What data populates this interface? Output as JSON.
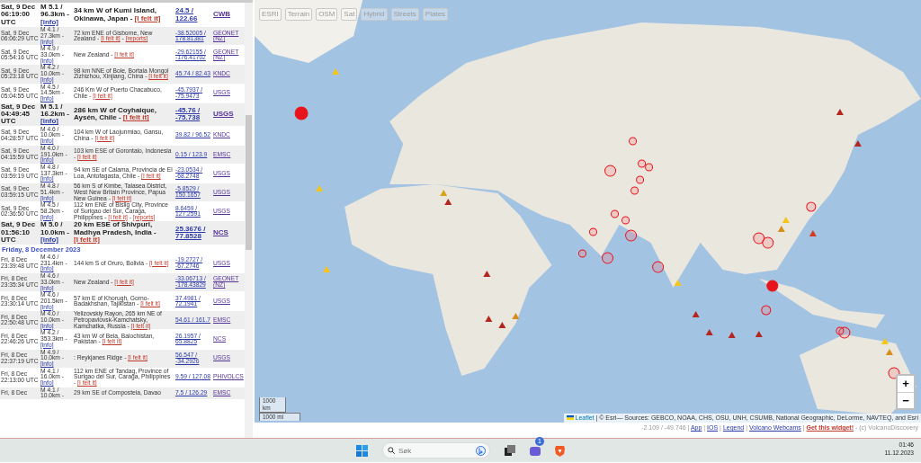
{
  "link_separator": " - ",
  "quake_list": {
    "rows": [
      {
        "kind": "quake",
        "strong": true,
        "date": "Sat, 9 Dec 06:19:00 UTC",
        "magnitude": "M 5.1 / 96.3km -",
        "info": "[info]",
        "place": "34 km W of Kumi Island, Okinawa, Japan",
        "links": [
          "[I felt it]"
        ],
        "coords": "24.5 / 122.66",
        "source": "CWB"
      },
      {
        "kind": "quake",
        "strong": false,
        "date": "Sat, 9 Dec 06:06:29 UTC",
        "magnitude": "M 4.1 / 27.3km -",
        "info": "[info]",
        "place": "72 km ENE of Gisborne, New Zealand",
        "links": [
          "[I felt it]",
          "[reports]"
        ],
        "coords": "-38.52005 / 178.81381",
        "source": "GEONET (NZ)"
      },
      {
        "kind": "quake",
        "strong": false,
        "date": "Sat, 9 Dec 05:54:16 UTC",
        "magnitude": "M 4.9 / 33.0km -",
        "info": "[info]",
        "place": "New Zealand",
        "links": [
          "[I felt it]"
        ],
        "coords": "-29.62155 / -176.41702",
        "source": "GEONET (NZ)"
      },
      {
        "kind": "quake",
        "strong": false,
        "date": "Sat, 9 Dec 05:23:18 UTC",
        "magnitude": "M 4.2 / 10.0km -",
        "info": "[info]",
        "place": "98 km NNE of Bole, Bortala Mongol Zizhizhou, Xinjiang, China",
        "links": [
          "[I felt it]"
        ],
        "coords": "45.74 / 82.43",
        "source": "KNDC"
      },
      {
        "kind": "quake",
        "strong": false,
        "date": "Sat, 9 Dec 05:04:55 UTC",
        "magnitude": "M 4.5 / 14.5km -",
        "info": "[info]",
        "place": "246 Km W of Puerto Chacabuco, Chile",
        "links": [
          "[I felt it]"
        ],
        "coords": "-45.7937 / -75.9473",
        "source": "USGS"
      },
      {
        "kind": "quake",
        "strong": true,
        "date": "Sat, 9 Dec 04:49:45 UTC",
        "magnitude": "M 5.1 / 16.2km -",
        "info": "[info]",
        "place": "286 km W of Coyhaique, Aysén, Chile",
        "links": [
          "[I felt it]"
        ],
        "coords": "-45.76 / -75.738",
        "source": "USGS"
      },
      {
        "kind": "quake",
        "strong": false,
        "date": "Sat, 9 Dec 04:28:57 UTC",
        "magnitude": "M 4.6 / 10.0km -",
        "info": "[info]",
        "place": "104 km W of Laojunmiao, Gansu, China",
        "links": [
          "[I felt it]"
        ],
        "coords": "39.82 / 96.52",
        "source": "KNDC"
      },
      {
        "kind": "quake",
        "strong": false,
        "date": "Sat, 9 Dec 04:15:59 UTC",
        "magnitude": "M 4.0 / 191.0km -",
        "info": "[info]",
        "place": "103 km ESE of Gorontalo, Indonesia",
        "links": [
          "[I felt it]"
        ],
        "coords": "0.15 / 123.9",
        "source": "EMSC"
      },
      {
        "kind": "quake",
        "strong": false,
        "date": "Sat, 9 Dec 03:59:19 UTC",
        "magnitude": "M 4.8 / 137.3km -",
        "info": "[info]",
        "place": "94 km SE of Calama, Provincia de El Loa, Antofagasta, Chile",
        "links": [
          "[I felt it]"
        ],
        "coords": "-23.0534 / -68.2748",
        "source": "USGS"
      },
      {
        "kind": "quake",
        "strong": false,
        "date": "Sat, 9 Dec 03:59:15 UTC",
        "magnitude": "M 4.8 / 51.4km -",
        "info": "[info]",
        "place": "56 km S of Kimbe, Talasea District, West New Britain Province, Papua New Guinea",
        "links": [
          "[I felt it]"
        ],
        "coords": "-5.8529 / 150.1657",
        "source": "USGS"
      },
      {
        "kind": "quake",
        "strong": false,
        "date": "Sat, 9 Dec 02:36:50 UTC",
        "magnitude": "M 4.5 / 58.2km -",
        "info": "[info]",
        "place": "112 km ENE of Bislig City, Province of Surigao del Sur, Caraga, Philippines",
        "links": [
          "[I felt it]",
          "[reports]"
        ],
        "coords": "8.6459 / 127.2591",
        "source": "USGS"
      },
      {
        "kind": "quake",
        "strong": true,
        "date": "Sat, 9 Dec 01:56:10 UTC",
        "magnitude": "M 5.0 / 10.0km -",
        "info": "[info]",
        "place": "20 km ESE of Shivpuri, Madhya Pradesh, India",
        "links": [
          "[I felt it]"
        ],
        "coords": "25.3676 / 77.8528",
        "source": "NCS"
      },
      {
        "kind": "day",
        "label": "Friday, 8 December 2023"
      },
      {
        "kind": "quake",
        "strong": false,
        "date": "Fri, 8 Dec 23:39:48 UTC",
        "magnitude": "M 4.6 / 231.4km -",
        "info": "[info]",
        "place": "144 km S of Oruro, Bolivia",
        "links": [
          "[I felt it]"
        ],
        "coords": "-19.2727 / -67.2746",
        "source": "USGS"
      },
      {
        "kind": "quake",
        "strong": false,
        "date": "Fri, 8 Dec 23:35:34 UTC",
        "magnitude": "M 4.6 / 33.0km -",
        "info": "[info]",
        "place": "New Zealand",
        "links": [
          "[I felt it]"
        ],
        "coords": "-33.06713 / -178.43829",
        "source": "GEONET (NZ)"
      },
      {
        "kind": "quake",
        "strong": false,
        "date": "Fri, 8 Dec 23:30:14 UTC",
        "magnitude": "M 4.6 / 201.5km -",
        "info": "[info]",
        "place": "57 km E of Khorugh, Gorno-Badakhshan, Tajikistan",
        "links": [
          "[I felt it]"
        ],
        "coords": "37.4981 / 72.1941",
        "source": "USGS"
      },
      {
        "kind": "quake",
        "strong": false,
        "date": "Fri, 8 Dec 22:50:48 UTC",
        "magnitude": "M 4.0 / 10.0km -",
        "info": "[info]",
        "place": "Yelizovskiy Rayon, 265 km NE of Petropavlovsk-Kamchatsky, Kamchatka, Russia",
        "links": [
          "[I felt it]"
        ],
        "coords": "54.61 / 161.7",
        "source": "EMSC"
      },
      {
        "kind": "quake",
        "strong": false,
        "date": "Fri, 8 Dec 22:46:26 UTC",
        "magnitude": "M 4.2 / 353.3km -",
        "info": "[info]",
        "place": "43 km W of Bela, Balochistan, Pakistan",
        "links": [
          "[I felt it]"
        ],
        "coords": "26.1957 / 65.8825",
        "source": "NCS"
      },
      {
        "kind": "quake",
        "strong": false,
        "date": "Fri, 8 Dec 22:37:19 UTC",
        "magnitude": "M 4.9 / 10.0km -",
        "info": "[info]",
        "place": ": Reykjanes Ridge",
        "links": [
          "[I felt it]"
        ],
        "coords": "56.547 / -34.2926",
        "source": "USGS"
      },
      {
        "kind": "quake",
        "strong": false,
        "date": "Fri, 8 Dec 22:13:00 UTC",
        "magnitude": "M 4.1 / 16.0km -",
        "info": "[info]",
        "place": "112 km ENE of Tandag, Province of Surigao del Sur, Caraga, Philippines",
        "links": [
          "[I felt it]"
        ],
        "coords": "9.59 / 127.08",
        "source": "PHIVOLCS"
      },
      {
        "kind": "quake",
        "strong": false,
        "date": "Fri, 8 Dec",
        "magnitude": "M 4.1 / 10.0km -",
        "place": "29 km SE of Compostela, Davao",
        "links": [],
        "coords": "7.5 / 126.29",
        "source": "EMSC"
      }
    ]
  },
  "map": {
    "layer_buttons": [
      "ESRI",
      "Terrain",
      "OSM",
      "Sat",
      "Hybrid",
      "Streets",
      "Plates"
    ],
    "zoom_in": "+",
    "zoom_out": "−",
    "scale": [
      "1000 km",
      "1000 mi"
    ],
    "attribution_link": "Leaflet",
    "attribution_text": "| © Esri— Sources: GEBCO, NOAA, CHS, OSU, UNH, CSUMB, National Geographic, DeLorme, NAVTEQ, and Esri"
  },
  "footer": {
    "cursor_coords": "-2.109 / -49.746",
    "separator": "|",
    "links": [
      {
        "label": "App",
        "kind": "plain"
      },
      {
        "label": "IOS",
        "kind": "plain"
      },
      {
        "label": "Legend",
        "kind": "plain"
      },
      {
        "label": "Volcano Webcams",
        "kind": "plain"
      },
      {
        "label": "Get this widget!",
        "kind": "promo"
      }
    ],
    "credit": "- (c) VolcanoDiscovery"
  },
  "taskbar": {
    "search_placeholder": "Søk",
    "chat_badge": "1",
    "time": "01:46",
    "date": "11.12.2023"
  }
}
